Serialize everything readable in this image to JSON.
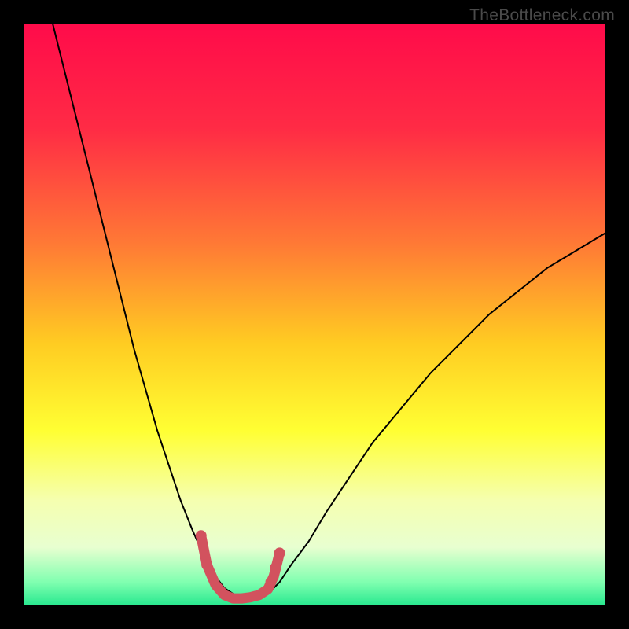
{
  "watermark": "TheBottleneck.com",
  "chart_data": {
    "type": "line",
    "title": "",
    "xlabel": "",
    "ylabel": "",
    "xlim": [
      0,
      100
    ],
    "ylim": [
      0,
      100
    ],
    "gradient_stops": [
      {
        "offset": 0,
        "color": "#ff0b4a"
      },
      {
        "offset": 18,
        "color": "#ff2b45"
      },
      {
        "offset": 38,
        "color": "#ff7a35"
      },
      {
        "offset": 55,
        "color": "#ffcc22"
      },
      {
        "offset": 70,
        "color": "#ffff33"
      },
      {
        "offset": 82,
        "color": "#f5ffb0"
      },
      {
        "offset": 90,
        "color": "#e8ffd0"
      },
      {
        "offset": 96,
        "color": "#80ffb0"
      },
      {
        "offset": 100,
        "color": "#28e88f"
      }
    ],
    "series": [
      {
        "name": "left_branch",
        "stroke": "#000000",
        "stroke_width": 2,
        "x": [
          5,
          7,
          9,
          11,
          13,
          15,
          17,
          19,
          21,
          23,
          25,
          27,
          29,
          31,
          33,
          34.5,
          36
        ],
        "y": [
          100,
          92,
          84,
          76,
          68,
          60,
          52,
          44,
          37,
          30,
          24,
          18,
          13,
          8.5,
          5,
          3,
          2
        ]
      },
      {
        "name": "right_branch",
        "stroke": "#000000",
        "stroke_width": 2,
        "x": [
          42,
          44,
          46,
          49,
          52,
          56,
          60,
          65,
          70,
          75,
          80,
          85,
          90,
          95,
          100
        ],
        "y": [
          2,
          4,
          7,
          11,
          16,
          22,
          28,
          34,
          40,
          45,
          50,
          54,
          58,
          61,
          64
        ]
      },
      {
        "name": "valley_marker",
        "stroke": "#d2525e",
        "stroke_width": 13,
        "linecap": "round",
        "x": [
          30.5,
          31.5,
          33,
          34.5,
          36,
          37.5,
          39,
          40.5,
          42,
          43,
          44
        ],
        "y": [
          12,
          7,
          3.5,
          1.8,
          1.2,
          1.2,
          1.4,
          1.8,
          2.8,
          5,
          9
        ]
      }
    ],
    "marker_dots": {
      "color": "#d2525e",
      "radius": 7,
      "points": [
        {
          "x": 30.5,
          "y": 12
        },
        {
          "x": 31.5,
          "y": 7
        },
        {
          "x": 44,
          "y": 9
        },
        {
          "x": 43.3,
          "y": 6.5
        },
        {
          "x": 42.5,
          "y": 4
        }
      ]
    }
  }
}
